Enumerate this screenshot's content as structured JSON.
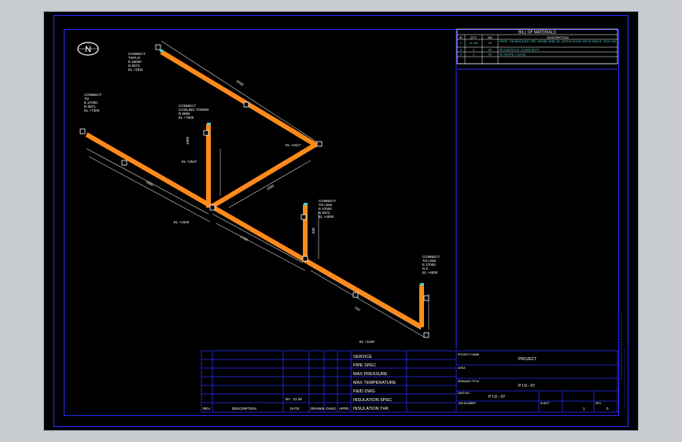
{
  "north_label": "N",
  "bom": {
    "title": "BILL OF MATERIALS",
    "headers": [
      "ID",
      "QTY",
      "ND",
      "DESCRIPTION"
    ],
    "rows": [
      {
        "id": "1",
        "qty": "11.4M",
        "nd": "50",
        "desc": "PIPE, SEAMLESS, PE, ASME B36.10, ASTM A106 GR B SMLS, SCH 40"
      },
      {
        "id": "2",
        "qty": "4",
        "nd": "50",
        "desc": "90 ELBOW LR, CLEAN BUTT"
      },
      {
        "id": "3",
        "qty": "3",
        "nd": "50",
        "desc": "90 SHOPE 1 EDGE"
      }
    ]
  },
  "pipe_labels": {
    "top_conn": [
      "CONNECT",
      "TOPLO",
      "E 26000",
      "N 8373",
      "EL +2511"
    ],
    "left_conn": [
      "CONNECT",
      "TO",
      "E 27000",
      "N 8371",
      "EL +7300"
    ],
    "mid_conn": [
      "CONNECT",
      "COOLING TOWER",
      "N 5850",
      "EL +7500"
    ],
    "right_conn": [
      "CONNECT",
      "TO LINE",
      "E 27000",
      "N 8373",
      "EL +4000"
    ],
    "far_conn": [
      "CONNECT",
      "TO LINE",
      "E 27000",
      "N 0",
      "EL +4000"
    ],
    "elev_a": "EL +2417",
    "elev_b": "EL +2547",
    "elev_c": "EL +1600",
    "elev_d": "EL +1100",
    "dim_a": "2000",
    "dim_b": "1500",
    "dim_c": "1700",
    "dim_d": "700",
    "dim_e": "1900",
    "dim_f": "1000",
    "dim_g": "500"
  },
  "title_block": {
    "left_headers": [
      "REV",
      "DESCRIPTION",
      "DATE",
      "DRAWN",
      "CHKD",
      "APPD"
    ],
    "scale_note": "BY : 21.36",
    "fields": [
      "SERVICE",
      "PIPE SPEC",
      "MAX PRESSURE",
      "MAX TEMPERATURE",
      "P&ID DWG",
      "INSULATION SPEC",
      "INSULATION THK"
    ],
    "project_label": "PROJECT NAME",
    "project_value": "PROJECT",
    "area_label": "AREA",
    "drawing_label": "DRAWING TITLE",
    "drawing_value": "P I D - 07",
    "dwg_no_label": "DWG NO.",
    "dwg_no_value": "P I D - 07",
    "job_label": "JOB NUMBER",
    "sheet_label": "SHEET",
    "sheet_value": "1",
    "rev_label": "REV",
    "rev_value": "0"
  }
}
